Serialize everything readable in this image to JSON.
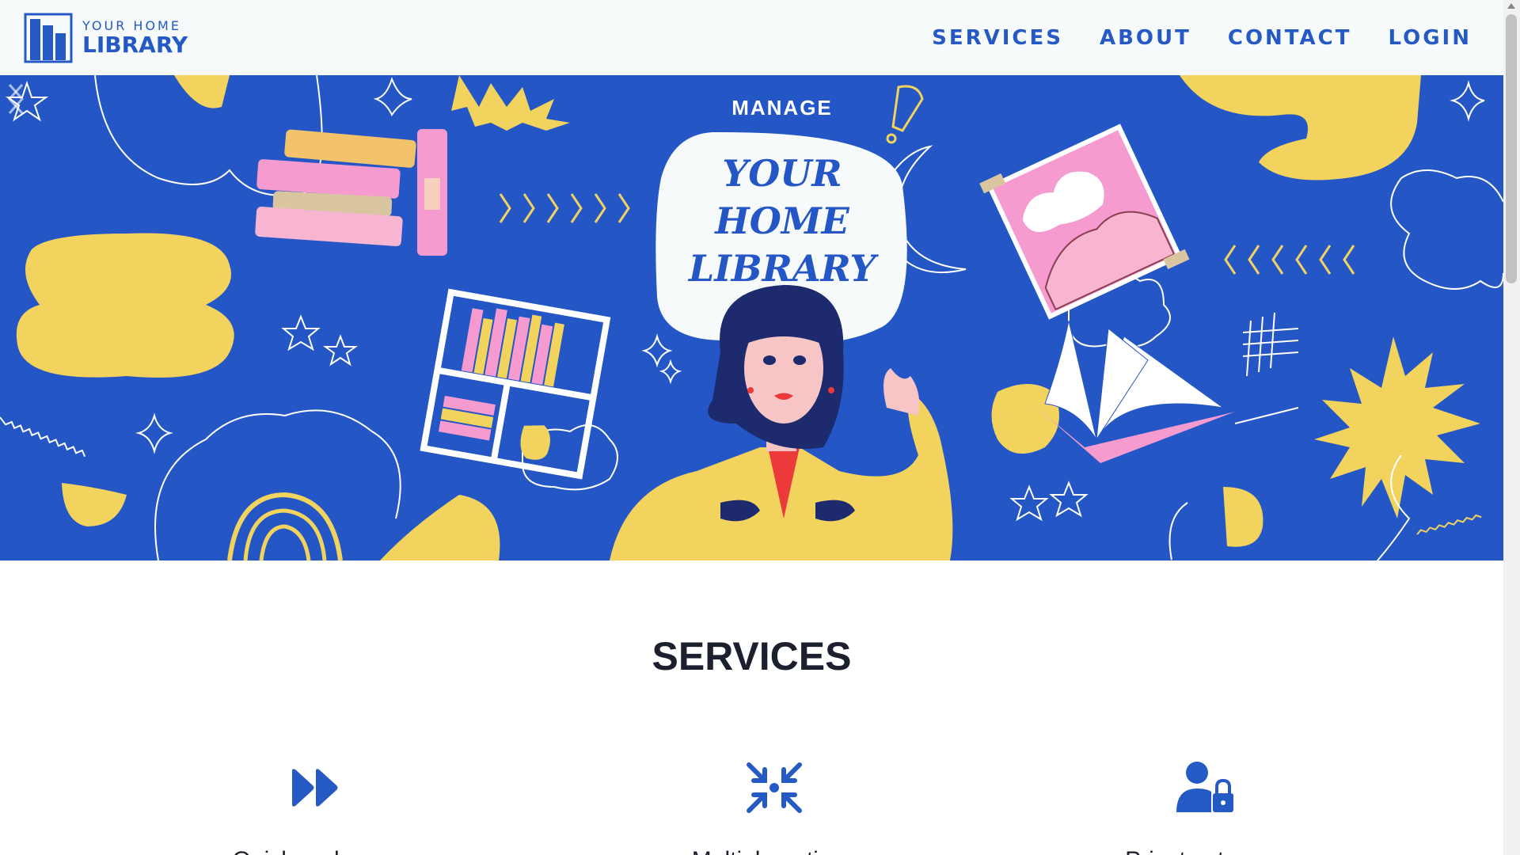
{
  "brand": {
    "small": "YOUR HOME",
    "big": "LIBRARY"
  },
  "nav": [
    {
      "label": "SERVICES"
    },
    {
      "label": "ABOUT"
    },
    {
      "label": "CONTACT"
    },
    {
      "label": "LOGIN"
    }
  ],
  "hero": {
    "kicker": "MANAGE",
    "bubble": [
      "YOUR",
      "HOME",
      "LIBRARY"
    ],
    "prev_icon": "chevron-left-icon",
    "next_icon": "chevron-right-icon"
  },
  "services": {
    "title": "SERVICES",
    "items": [
      {
        "icon": "fast-forward-icon",
        "title": "Quick and easy"
      },
      {
        "icon": "compress-arrows-icon",
        "title": "Multiple options"
      },
      {
        "icon": "user-lock-icon",
        "title": "Private storage"
      }
    ]
  },
  "colors": {
    "brand_blue": "#2457c5",
    "accent_yellow": "#f2d35e",
    "accent_pink": "#f59bd0",
    "dark_text": "#1b1f2e"
  }
}
